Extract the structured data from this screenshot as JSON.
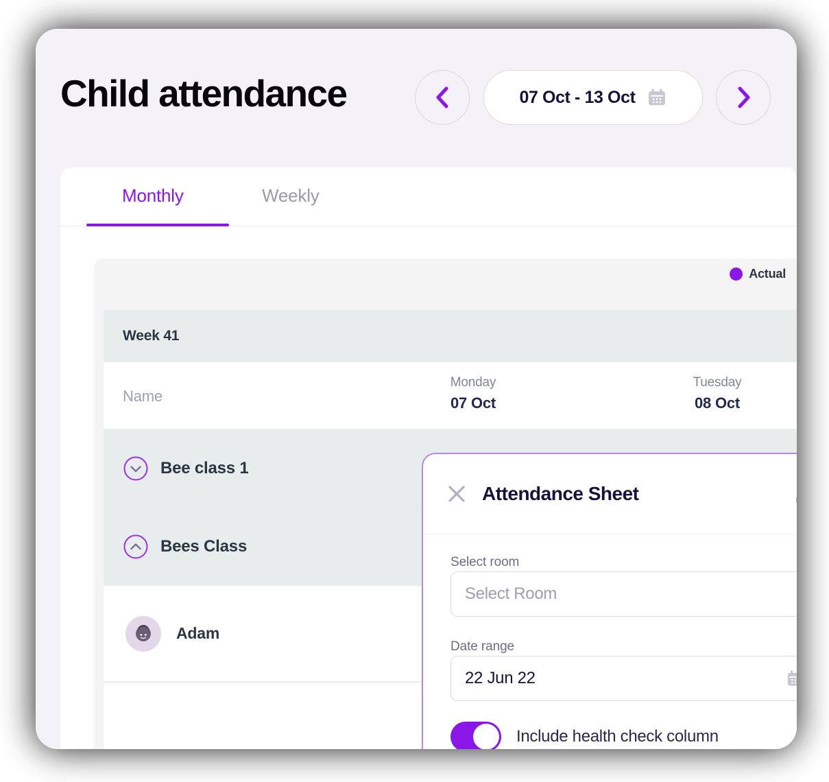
{
  "header": {
    "title": "Child attendance",
    "prev_icon": "chevron-left-icon",
    "next_icon": "chevron-right-icon",
    "date_range": "07 Oct - 13 Oct",
    "calendar_icon": "calendar-icon"
  },
  "tabs": [
    {
      "label": "Monthly",
      "active": true
    },
    {
      "label": "Weekly",
      "active": false
    }
  ],
  "table": {
    "legend": {
      "label": "Actual",
      "color": "#8b16e8",
      "icon": "legend-dot-icon"
    },
    "week_label": "Week 41",
    "name_column_header": "Name",
    "day_columns": [
      {
        "day": "Monday",
        "date": "07 Oct"
      },
      {
        "day": "Tuesday",
        "date": "08 Oct"
      }
    ],
    "class_rows": [
      {
        "label": "Bee class 1",
        "icon": "chevron-down-circle-icon",
        "expanded": false
      },
      {
        "label": "Bees Class",
        "icon": "chevron-up-circle-icon",
        "expanded": true
      }
    ],
    "child_rows": [
      {
        "name": "Adam",
        "avatar_icon": "child-avatar-icon"
      }
    ]
  },
  "modal": {
    "title": "Attendance Sheet",
    "close_icon": "close-icon",
    "expand_icon": "expand-diagonal-icon",
    "select_room": {
      "label": "Select room",
      "placeholder": "Select Room",
      "value": ""
    },
    "date_range": {
      "label": "Date range",
      "value": "22 Jun 22",
      "calendar_icon": "calendar-icon"
    },
    "health_check": {
      "label": "Include health check column",
      "enabled": true
    }
  },
  "colors": {
    "accent": "#8b16e8",
    "modal_border": "#b586f0",
    "week_row_bg": "#e7edec",
    "panel_bg": "#f4f2f7"
  }
}
